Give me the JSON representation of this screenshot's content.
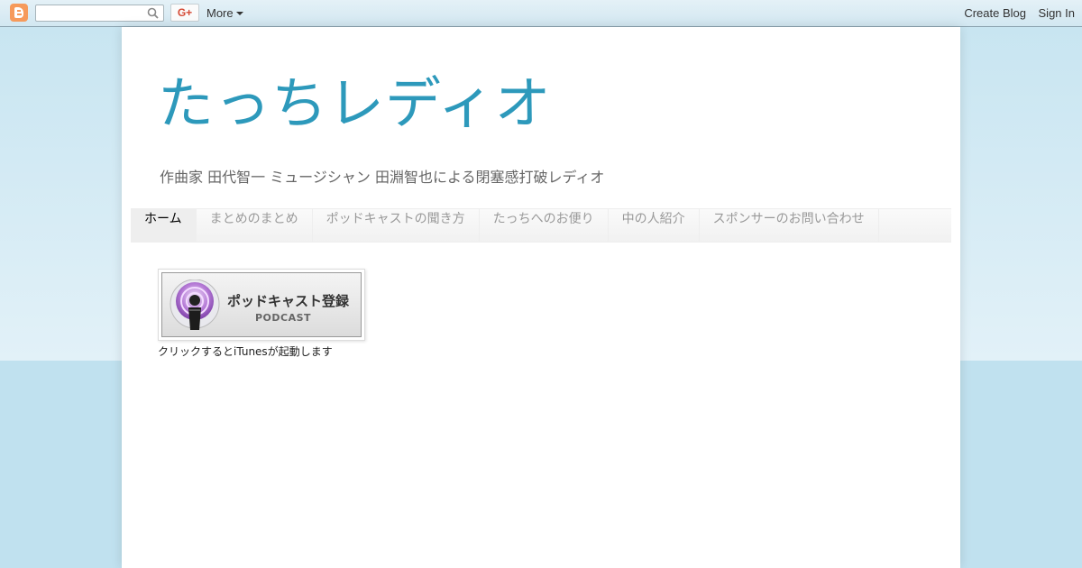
{
  "navbar": {
    "search": {
      "value": "",
      "placeholder": ""
    },
    "gplus_label": "G+",
    "more_label": "More",
    "create_blog_label": "Create Blog",
    "sign_in_label": "Sign In"
  },
  "header": {
    "title": "たっちレディオ",
    "description": "作曲家 田代智一 ミュージシャン 田淵智也による閉塞感打破レディオ"
  },
  "tabs": [
    {
      "label": "ホーム",
      "selected": true
    },
    {
      "label": "まとめのまとめ",
      "selected": false
    },
    {
      "label": "ポッドキャストの聞き方",
      "selected": false
    },
    {
      "label": "たっちへのお便り",
      "selected": false
    },
    {
      "label": "中の人紹介",
      "selected": false
    },
    {
      "label": "スポンサーのお問い合わせ",
      "selected": false
    }
  ],
  "podcast": {
    "label_jp": "ポッドキャスト登録",
    "label_en": "PODCAST",
    "caption": "クリックするとiTunesが起動します"
  },
  "colors": {
    "background": "#c0e1ef",
    "title": "#2d99bb",
    "blogger_orange": "#f69a5b",
    "gplus_red": "#d54a35"
  },
  "icons": [
    "blogger-logo-icon",
    "search-icon",
    "more-caret-icon",
    "podcast-icon"
  ]
}
